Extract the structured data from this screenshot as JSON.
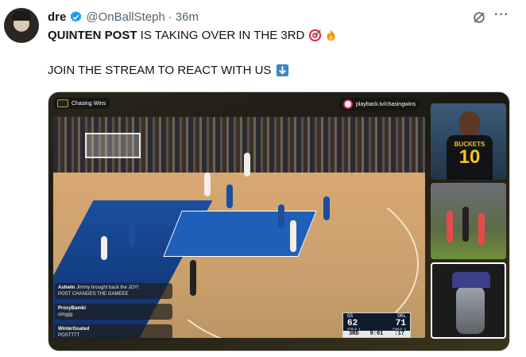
{
  "tweet": {
    "display_name": "dre",
    "handle": "@OnBallSteph",
    "separator": "·",
    "time": "36m",
    "line1_bold": "QUINTEN POST",
    "line1_rest": " IS TAKING OVER IN THE 3RD",
    "line2": "JOIN THE STREAM TO REACT WITH US",
    "more": "···"
  },
  "stream": {
    "channel_label": "Chasing Wins",
    "url_label": "playback.tv/chasingwins",
    "scoreboard": {
      "team_left": "GS",
      "team_right": "ORL",
      "score_left": "62",
      "score_right": "71",
      "fouls_left": "FOULS 1",
      "fouls_right": "FOULS 1",
      "period": "3RD",
      "clock": "9:01",
      "shot_clock": ":17"
    },
    "chat": [
      {
        "user": "Ashwin",
        "msg_top": "Jimmy brought back the JOY!",
        "msg": "POST CHANGES THE GAMEEE"
      },
      {
        "user": "ProxyBambi",
        "msg": "omggg"
      },
      {
        "user": "WinterGoated",
        "msg": "POSTTTT"
      }
    ],
    "side_panel": {
      "jersey_name": "BUCKETS",
      "jersey_number": "10"
    }
  }
}
